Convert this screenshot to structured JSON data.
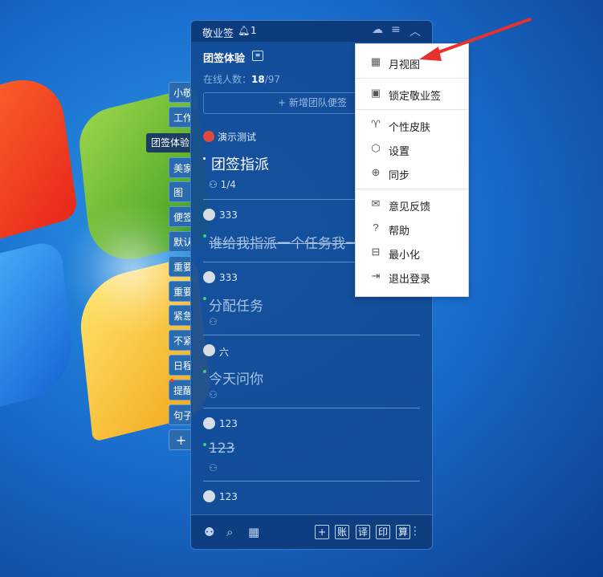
{
  "side_tabs": [
    "小敬",
    "工作",
    "美家",
    "图",
    "便签",
    "默认",
    "重要",
    "重要",
    "紧急",
    "不紧",
    "日程",
    "提醒",
    "句子",
    "+"
  ],
  "active_tab": "团签体验",
  "app": {
    "title": "敬业签",
    "bell_count": "1",
    "team_title": "团签体验",
    "online_label": "在线人数：",
    "online_now": "18",
    "online_total": "/97",
    "add_team_note": "新增团队便签",
    "demo_label": "演示测试",
    "assign_title": "团签指派",
    "assign_count": "1/4"
  },
  "notes": [
    {
      "user": "333",
      "task": "谁给我指派一个任务我一",
      "strike": true
    },
    {
      "user": "333",
      "task": "分配任务",
      "strike": false
    },
    {
      "user": "六",
      "task": "今天问你",
      "strike": false
    },
    {
      "user": "123",
      "task": "123",
      "strike": true
    },
    {
      "user": "123",
      "task": "",
      "strike": false
    }
  ],
  "bottom_tools": [
    "账",
    "译",
    "印",
    "算"
  ],
  "menu": {
    "items": [
      {
        "icon": "calendar-icon",
        "label": "月视图"
      },
      {
        "icon": "lock-icon",
        "label": "锁定敬业签"
      },
      {
        "icon": "shirt-icon",
        "label": "个性皮肤"
      },
      {
        "icon": "gear-icon",
        "label": "设置"
      },
      {
        "icon": "sync-icon",
        "label": "同步"
      },
      {
        "icon": "mail-icon",
        "label": "意见反馈"
      },
      {
        "icon": "help-icon",
        "label": "帮助"
      },
      {
        "icon": "minimize-icon",
        "label": "最小化"
      },
      {
        "icon": "logout-icon",
        "label": "退出登录"
      }
    ]
  },
  "colors": {
    "panel": "#124b96",
    "accent_arrow": "#e8322d",
    "note_dot": "#39d27a"
  }
}
